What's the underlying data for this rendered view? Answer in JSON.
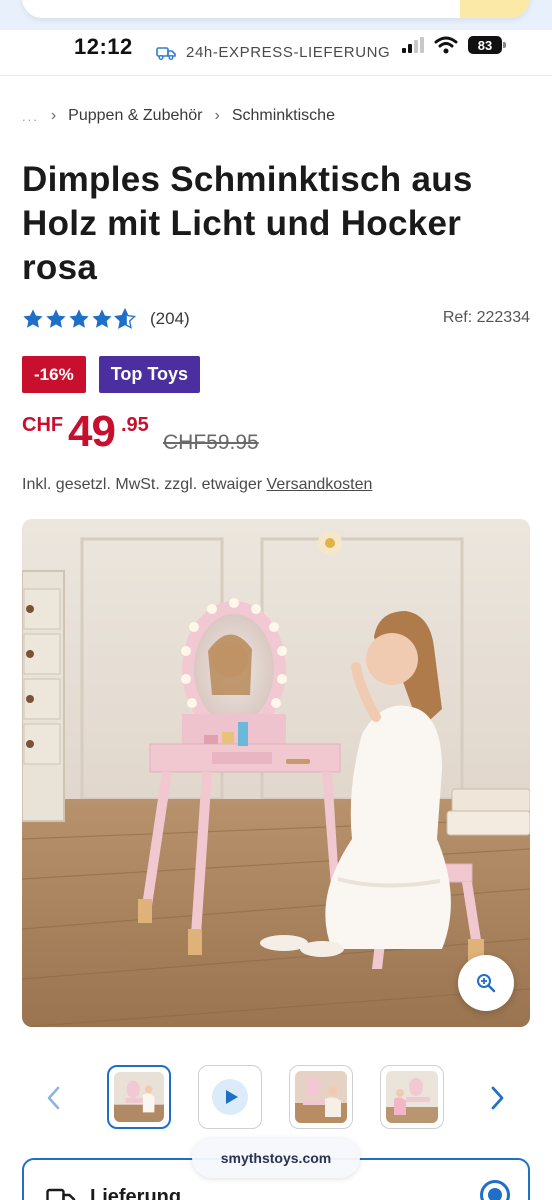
{
  "status_bar": {
    "time": "12:12",
    "express_text": "24h-EXPRESS-LIEFERUNG",
    "battery": "83"
  },
  "breadcrumb": {
    "ellipsis": "...",
    "items": [
      "Puppen & Zubehör",
      "Schminktische"
    ]
  },
  "product": {
    "title": "Dimples Schminktisch aus Holz mit Licht und Hocker rosa",
    "rating_count": "(204)",
    "rating_value": 4.5,
    "ref": "Ref: 222334",
    "badges": {
      "discount": "-16%",
      "label": "Top Toys"
    },
    "price": {
      "currency": "CHF",
      "integer": "49",
      "decimal": ".95",
      "old": "CHF59.95"
    },
    "tax_text": "Inkl. gesetzl. MwSt. zzgl. etwaiger",
    "shipping_link": "Versandkosten"
  },
  "gallery": {
    "main_image": "pink-vanity-table-girl",
    "zoom_icon": "zoom-in-icon",
    "thumbnails": [
      "vanity-thumb-1",
      "video-play-thumb",
      "vanity-thumb-3",
      "vanity-thumb-4"
    ],
    "active_index": 0
  },
  "watermark": "smythstoys.com",
  "delivery": {
    "label": "Lieferung",
    "icon": "truck-icon",
    "selected": true
  },
  "colors": {
    "accent_blue": "#1f6fc9",
    "sale_red": "#c8102e",
    "badge_purple": "#4b2fa0",
    "star_blue": "#1f6fc9"
  }
}
